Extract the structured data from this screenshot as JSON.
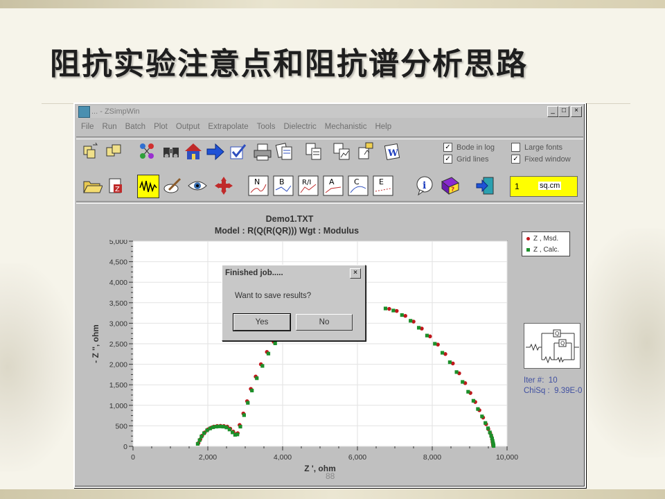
{
  "slide": {
    "title": "阻抗实验注意点和阻抗谱分析思路",
    "page_number": "88"
  },
  "window": {
    "title": "... - ZSimpWin",
    "buttons": [
      "_",
      "□",
      "×"
    ]
  },
  "menu": [
    "File",
    "Run",
    "Batch",
    "Plot",
    "Output",
    "Extrapolate",
    "Tools",
    "Dielectric",
    "Mechanistic",
    "Help"
  ],
  "toolbar1": {
    "icons": [
      "open-files-icon",
      "save-files-icon",
      "molecule-icon",
      "binoculars-icon",
      "home-icon",
      "arrow-right-icon",
      "checkmark-icon",
      "printer-icon",
      "documents-icon",
      "copy-icon",
      "copy-plot-icon",
      "paste-icon",
      "word-icon"
    ],
    "options": [
      {
        "label": "Bode in log",
        "checked": true
      },
      {
        "label": "Grid lines",
        "checked": true
      },
      {
        "label": "Large fonts",
        "checked": false
      },
      {
        "label": "Fixed window",
        "checked": true
      }
    ]
  },
  "toolbar2": {
    "icons": [
      "open-folder-icon",
      "zip-icon",
      "fit-icon",
      "edit-icon",
      "eye-icon",
      "move-icon",
      "plot-n-icon",
      "plot-b-icon",
      "plot-r-icon",
      "plot-a-icon",
      "plot-c-icon",
      "plot-e-icon",
      "info-icon",
      "help-book-icon",
      "exit-icon"
    ],
    "plot_letters": [
      "N",
      "B",
      "R/I",
      "A",
      "C",
      "E"
    ],
    "area_value": "1",
    "area_unit": "sq.cm"
  },
  "plot": {
    "title": "Demo1.TXT",
    "subtitle": "Model : R(Q(R(QR)))      Wgt : Modulus",
    "legend": [
      "Z , Msd.",
      "Z , Calc."
    ],
    "iter_label": "Iter #:",
    "iter_value": "10",
    "chisq_label": "ChiSq :",
    "chisq_value": "9.39E-0"
  },
  "dialog": {
    "title": "Finished job.....",
    "message": "Want to save results?",
    "yes": "Yes",
    "no": "No",
    "close": "×"
  },
  "colors": {
    "measured": "#c0171c",
    "calculated": "#1c8f2a",
    "yellow": "#ffff00"
  },
  "chart_data": {
    "type": "scatter",
    "xlabel": "Z ', ohm",
    "ylabel": "- Z '', ohm",
    "xlim": [
      0,
      10000
    ],
    "ylim": [
      0,
      5000
    ],
    "xticks": [
      "0",
      "2,000",
      "4,000",
      "6,000",
      "8,000",
      "10,000"
    ],
    "yticks": [
      "0",
      "500",
      "1,000",
      "1,500",
      "2,000",
      "2,500",
      "3,000",
      "3,500",
      "4,000",
      "4,500",
      "5,000"
    ],
    "grid": true,
    "legend_position": "top-right",
    "series": [
      {
        "name": "Z , Msd.",
        "marker": "circle",
        "x": [
          1750,
          1800,
          1850,
          1920,
          2000,
          2080,
          2160,
          2250,
          2340,
          2430,
          2520,
          2600,
          2680,
          2750,
          2800,
          2850,
          2950,
          3050,
          3150,
          3280,
          3420,
          3580,
          3760,
          3950,
          4150,
          6850,
          7050,
          7280,
          7500,
          7720,
          7940,
          8150,
          8350,
          8550,
          8720,
          8880,
          9020,
          9150,
          9260,
          9360,
          9440,
          9500,
          9550,
          9580,
          9600,
          9610,
          9620,
          9625,
          9630,
          9630
        ],
        "y": [
          80,
          170,
          260,
          340,
          410,
          450,
          480,
          495,
          500,
          495,
          480,
          430,
          360,
          300,
          320,
          520,
          800,
          1100,
          1400,
          1700,
          2000,
          2300,
          2550,
          2750,
          2900,
          3350,
          3300,
          3180,
          3040,
          2870,
          2680,
          2480,
          2250,
          2020,
          1780,
          1540,
          1300,
          1080,
          880,
          700,
          540,
          420,
          320,
          240,
          170,
          110,
          70,
          40,
          20,
          10
        ]
      },
      {
        "name": "Z , Calc.",
        "marker": "square",
        "x": [
          1730,
          1780,
          1830,
          1900,
          1980,
          2060,
          2140,
          2230,
          2320,
          2410,
          2500,
          2580,
          2660,
          2730,
          2790,
          2870,
          2970,
          3070,
          3180,
          3310,
          3460,
          3620,
          3800,
          3990,
          4190,
          6750,
          6960,
          7190,
          7420,
          7640,
          7860,
          8070,
          8270,
          8470,
          8650,
          8810,
          8960,
          9100,
          9220,
          9330,
          9420,
          9490,
          9540,
          9575,
          9600,
          9615,
          9625,
          9632,
          9636,
          9640
        ],
        "y": [
          60,
          150,
          240,
          320,
          390,
          435,
          465,
          480,
          485,
          480,
          460,
          410,
          340,
          280,
          290,
          480,
          760,
          1060,
          1360,
          1660,
          1960,
          2260,
          2510,
          2720,
          2880,
          3360,
          3310,
          3200,
          3060,
          2890,
          2700,
          2500,
          2280,
          2050,
          1810,
          1570,
          1330,
          1110,
          910,
          730,
          570,
          440,
          340,
          260,
          190,
          130,
          80,
          50,
          25,
          10
        ]
      }
    ]
  }
}
